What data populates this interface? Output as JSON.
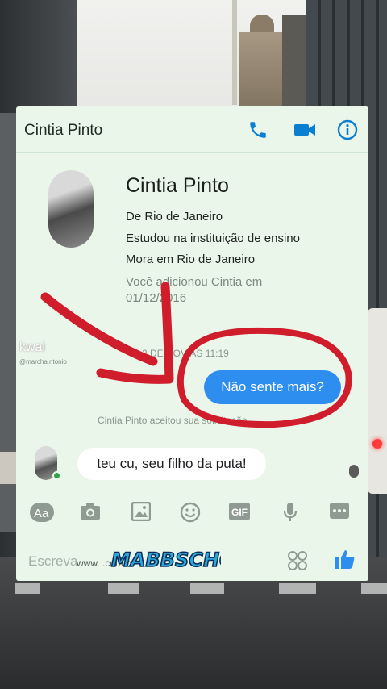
{
  "header": {
    "title": "Cintia Pinto",
    "icons": [
      "phone-icon",
      "video-camera-icon",
      "info-icon"
    ]
  },
  "profile": {
    "name": "Cintia Pinto",
    "lines": [
      "De Rio de Janeiro",
      "Estudou na instituição de ensino",
      "Mora em Rio de Janeiro"
    ],
    "added_note": "Você adicionou Cintia em 01/12/2016"
  },
  "conversation": {
    "timestamp": "2 DE NOV ÀS 11:19",
    "sent_message": "Não sente mais?",
    "accepted_note": "Cintia Pinto aceitou sua solicitação",
    "received_message": "teu cu, seu filho da puta!"
  },
  "toolbar": {
    "aa_label": "Aa",
    "gif_label": "GIF",
    "icons": [
      "aa-icon",
      "camera-icon",
      "image-icon",
      "emoji-icon",
      "gif-icon",
      "mic-icon",
      "more-icon"
    ]
  },
  "composer": {
    "placeholder": "Escreva",
    "watermark_site": "www.                        .com.br",
    "watermark_logo": "MABBSCHO"
  },
  "overlay_watermark": {
    "app": "kwai",
    "user": "@marcha.ntonio"
  },
  "colors": {
    "accent_blue": "#2e8ef0",
    "header_icon": "#0a7fd1",
    "card_bg": "#ebf6eb",
    "red_markup": "#d01d2c"
  }
}
